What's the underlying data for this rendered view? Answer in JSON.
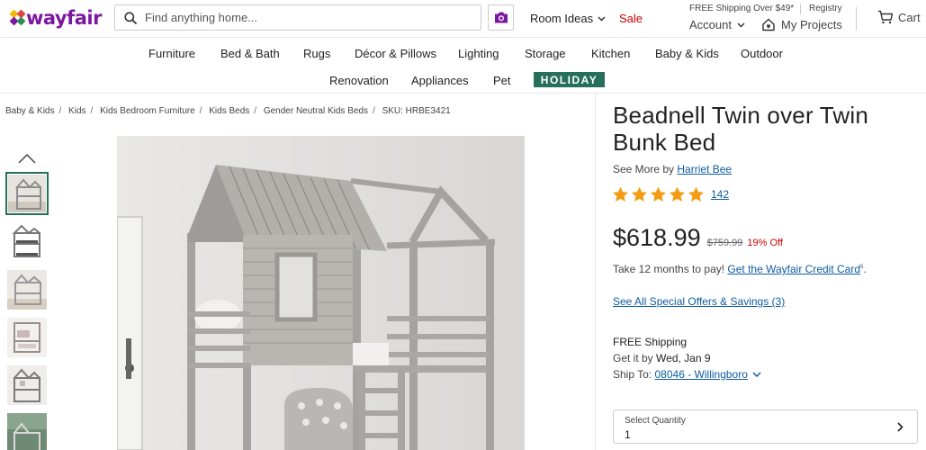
{
  "brand": {
    "logo_text": "wayfair",
    "accent": "#7b189f",
    "logo_colors": [
      "#f2b705",
      "#e0453c",
      "#7b189f",
      "#2e8c57"
    ]
  },
  "header": {
    "search_placeholder": "Find anything home...",
    "search_icon": "search-icon",
    "camera_icon": "camera-icon",
    "room_ideas": "Room Ideas",
    "sale": "Sale",
    "free_shipping": "FREE Shipping Over $49*",
    "registry": "Registry",
    "account": "Account",
    "my_projects": "My Projects",
    "cart": "Cart"
  },
  "nav": {
    "row1": [
      "Furniture",
      "Bed & Bath",
      "Rugs",
      "Décor & Pillows",
      "Lighting",
      "Storage",
      "Kitchen",
      "Baby & Kids",
      "Outdoor"
    ],
    "row2": [
      "Renovation",
      "Appliances",
      "Pet"
    ],
    "holiday": "HOLIDAY",
    "holiday_color": "#266f5d"
  },
  "breadcrumb": [
    "Baby & Kids",
    "Kids",
    "Kids Bedroom Furniture",
    "Kids Beds",
    "Gender Neutral Kids Beds",
    "SKU: HRBE3421"
  ],
  "product": {
    "title": "Beadnell Twin over Twin Bunk Bed",
    "see_more_prefix": "See More by",
    "brand_link": "Harriet Bee",
    "rating": 5,
    "review_count": "142",
    "price": "$618.99",
    "was_price": "$759.99",
    "discount": "19% Off",
    "credit_prefix": "Take 12 months to pay!",
    "credit_link": "Get the Wayfair Credit Card",
    "credit_sup": "5",
    "offers": "See All Special Offers & Savings (3)",
    "free_shipping": "FREE Shipping",
    "get_it_by": "Get it by",
    "delivery_date": "Wed, Jan 9",
    "ship_to": "Ship To:",
    "ship_to_location": "08046 - Willingboro",
    "qty_label": "Select Quantity",
    "qty_value": "1"
  }
}
